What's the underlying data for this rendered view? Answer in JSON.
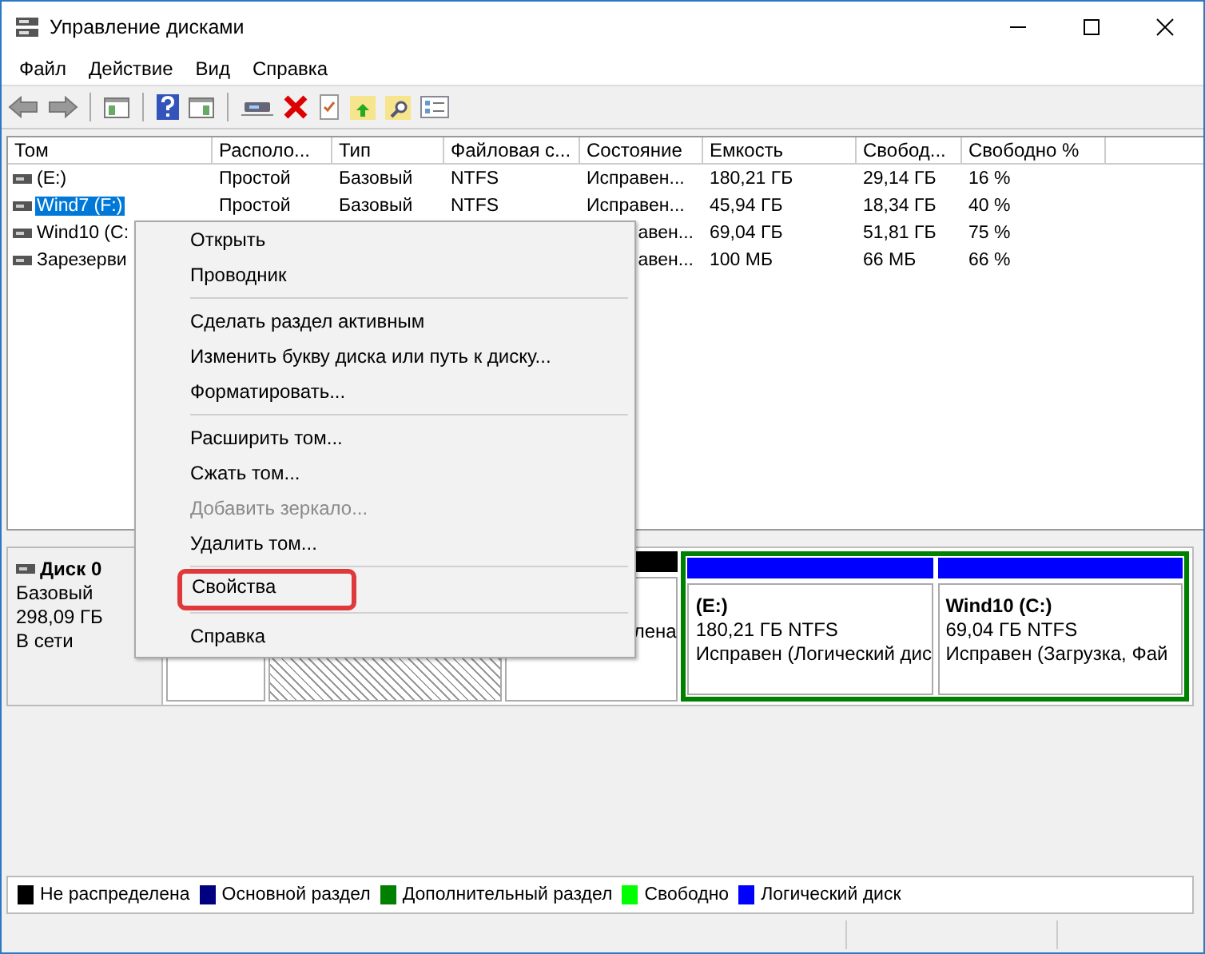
{
  "window": {
    "title": "Управление дисками"
  },
  "menu_bar": [
    "Файл",
    "Действие",
    "Вид",
    "Справка"
  ],
  "table": {
    "columns": [
      "Том",
      "Располо...",
      "Тип",
      "Файловая с...",
      "Состояние",
      "Емкость",
      "Свобод...",
      "Свободно %"
    ],
    "rows": [
      {
        "cells": [
          "(E:)",
          "Простой",
          "Базовый",
          "NTFS",
          "Исправен...",
          "180,21 ГБ",
          "29,14 ГБ",
          "16 %"
        ],
        "selected": false,
        "status_cut": false
      },
      {
        "cells": [
          "Wind7 (F:)",
          "Простой",
          "Базовый",
          "NTFS",
          "Исправен...",
          "45,94 ГБ",
          "18,34 ГБ",
          "40 %"
        ],
        "selected": true,
        "status_cut": false
      },
      {
        "cells": [
          "Wind10 (C:",
          "",
          "",
          "",
          "авен...",
          "69,04 ГБ",
          "51,81 ГБ",
          "75 %"
        ],
        "selected": false,
        "status_cut": true
      },
      {
        "cells": [
          "Зарезерви",
          "",
          "",
          "",
          "авен...",
          "100 МБ",
          "66 МБ",
          "66 %"
        ],
        "selected": false,
        "status_cut": true
      }
    ]
  },
  "context_menu": [
    {
      "kind": "item",
      "label": "Открыть",
      "disabled": false,
      "outlined": false
    },
    {
      "kind": "item",
      "label": "Проводник",
      "disabled": false,
      "outlined": false
    },
    {
      "kind": "separator"
    },
    {
      "kind": "item",
      "label": "Сделать раздел активным",
      "disabled": false,
      "outlined": false
    },
    {
      "kind": "item",
      "label": "Изменить букву диска или путь к диску...",
      "disabled": false,
      "outlined": false
    },
    {
      "kind": "item",
      "label": "Форматировать...",
      "disabled": false,
      "outlined": false
    },
    {
      "kind": "separator"
    },
    {
      "kind": "item",
      "label": "Расширить том...",
      "disabled": false,
      "outlined": false
    },
    {
      "kind": "item",
      "label": "Сжать том...",
      "disabled": false,
      "outlined": false
    },
    {
      "kind": "item",
      "label": "Добавить зеркало...",
      "disabled": true,
      "outlined": false
    },
    {
      "kind": "item",
      "label": "Удалить том...",
      "disabled": false,
      "outlined": false
    },
    {
      "kind": "separator"
    },
    {
      "kind": "item",
      "label": "Свойства",
      "disabled": false,
      "outlined": true
    },
    {
      "kind": "separator"
    },
    {
      "kind": "item",
      "label": "Справка",
      "disabled": false,
      "outlined": false
    }
  ],
  "disk": {
    "name": "Диск 0",
    "type": "Базовый",
    "size": "298,09 ГБ",
    "state": "В сети",
    "partitions": [
      {
        "kind": "box"
      },
      {
        "kind": "hatched"
      },
      {
        "kind": "unallocated",
        "text": "лена",
        "color": "#000000"
      },
      {
        "kind": "extended",
        "color": "#008000",
        "children": [
          {
            "name": "(E:)",
            "size": "180,21 ГБ NTFS",
            "status": "Исправен (Логический дис",
            "color": "#0000ff"
          },
          {
            "name": "Wind10  (C:)",
            "size": "69,04 ГБ NTFS",
            "status": "Исправен (Загрузка, Фай",
            "color": "#0000ff"
          }
        ]
      }
    ]
  },
  "legend": [
    {
      "label": "Не распределена",
      "color": "#000000"
    },
    {
      "label": "Основной раздел",
      "color": "#000080"
    },
    {
      "label": "Дополнительный раздел",
      "color": "#008000"
    },
    {
      "label": "Свободно",
      "color": "#00ff00"
    },
    {
      "label": "Логический диск",
      "color": "#0000ff"
    }
  ]
}
